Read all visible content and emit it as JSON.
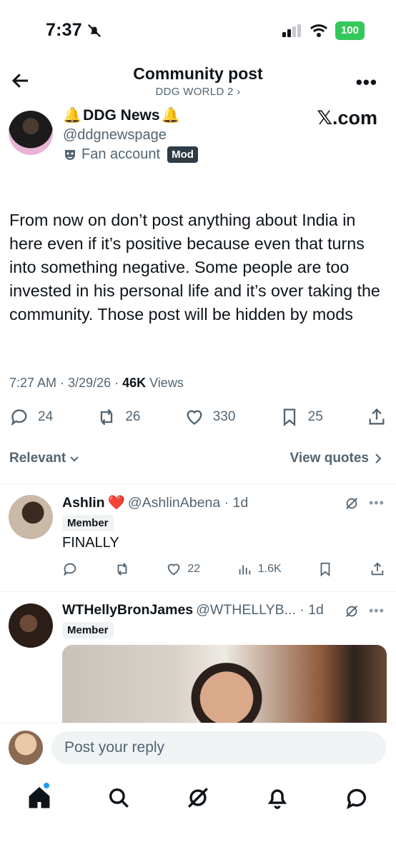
{
  "status": {
    "time": "7:37",
    "battery": "100"
  },
  "header": {
    "title": "Community post",
    "subtitle": "DDG WORLD 2 ›",
    "more": "•••"
  },
  "post": {
    "author_name": "DDG News",
    "author_handle": "@ddgnewspage",
    "fan_label": "Fan account",
    "mod_badge": "Mod",
    "source": "𝕏.com",
    "body": "From now on don’t post anything about India in here even if it’s positive because even that turns into something negative. Some people are too invested in his personal life and it’s over taking the community. Those post will be hidden by mods",
    "time": "7:27 AM · 3/29/26 · ",
    "views_count": "46K",
    "views_label": " Views",
    "replies": "24",
    "reposts": "26",
    "likes": "330",
    "bookmarks": "25"
  },
  "sort": {
    "label": "Relevant",
    "quotes_label": "View quotes"
  },
  "replies": [
    {
      "name": "Ashlin",
      "handle": "@AshlinAbena · 1d",
      "badge": "Member",
      "text": "FINALLY",
      "likes": "22",
      "views": "1.6K"
    },
    {
      "name": "WTHellyBronJames",
      "handle": "@WTHELLYB... · 1d",
      "badge": "Member"
    }
  ],
  "composer": {
    "placeholder": "Post your reply"
  },
  "colors": {
    "accent": "#1d9bf0",
    "text": "#0f1419",
    "muted": "#536471",
    "battery": "#34c759"
  }
}
